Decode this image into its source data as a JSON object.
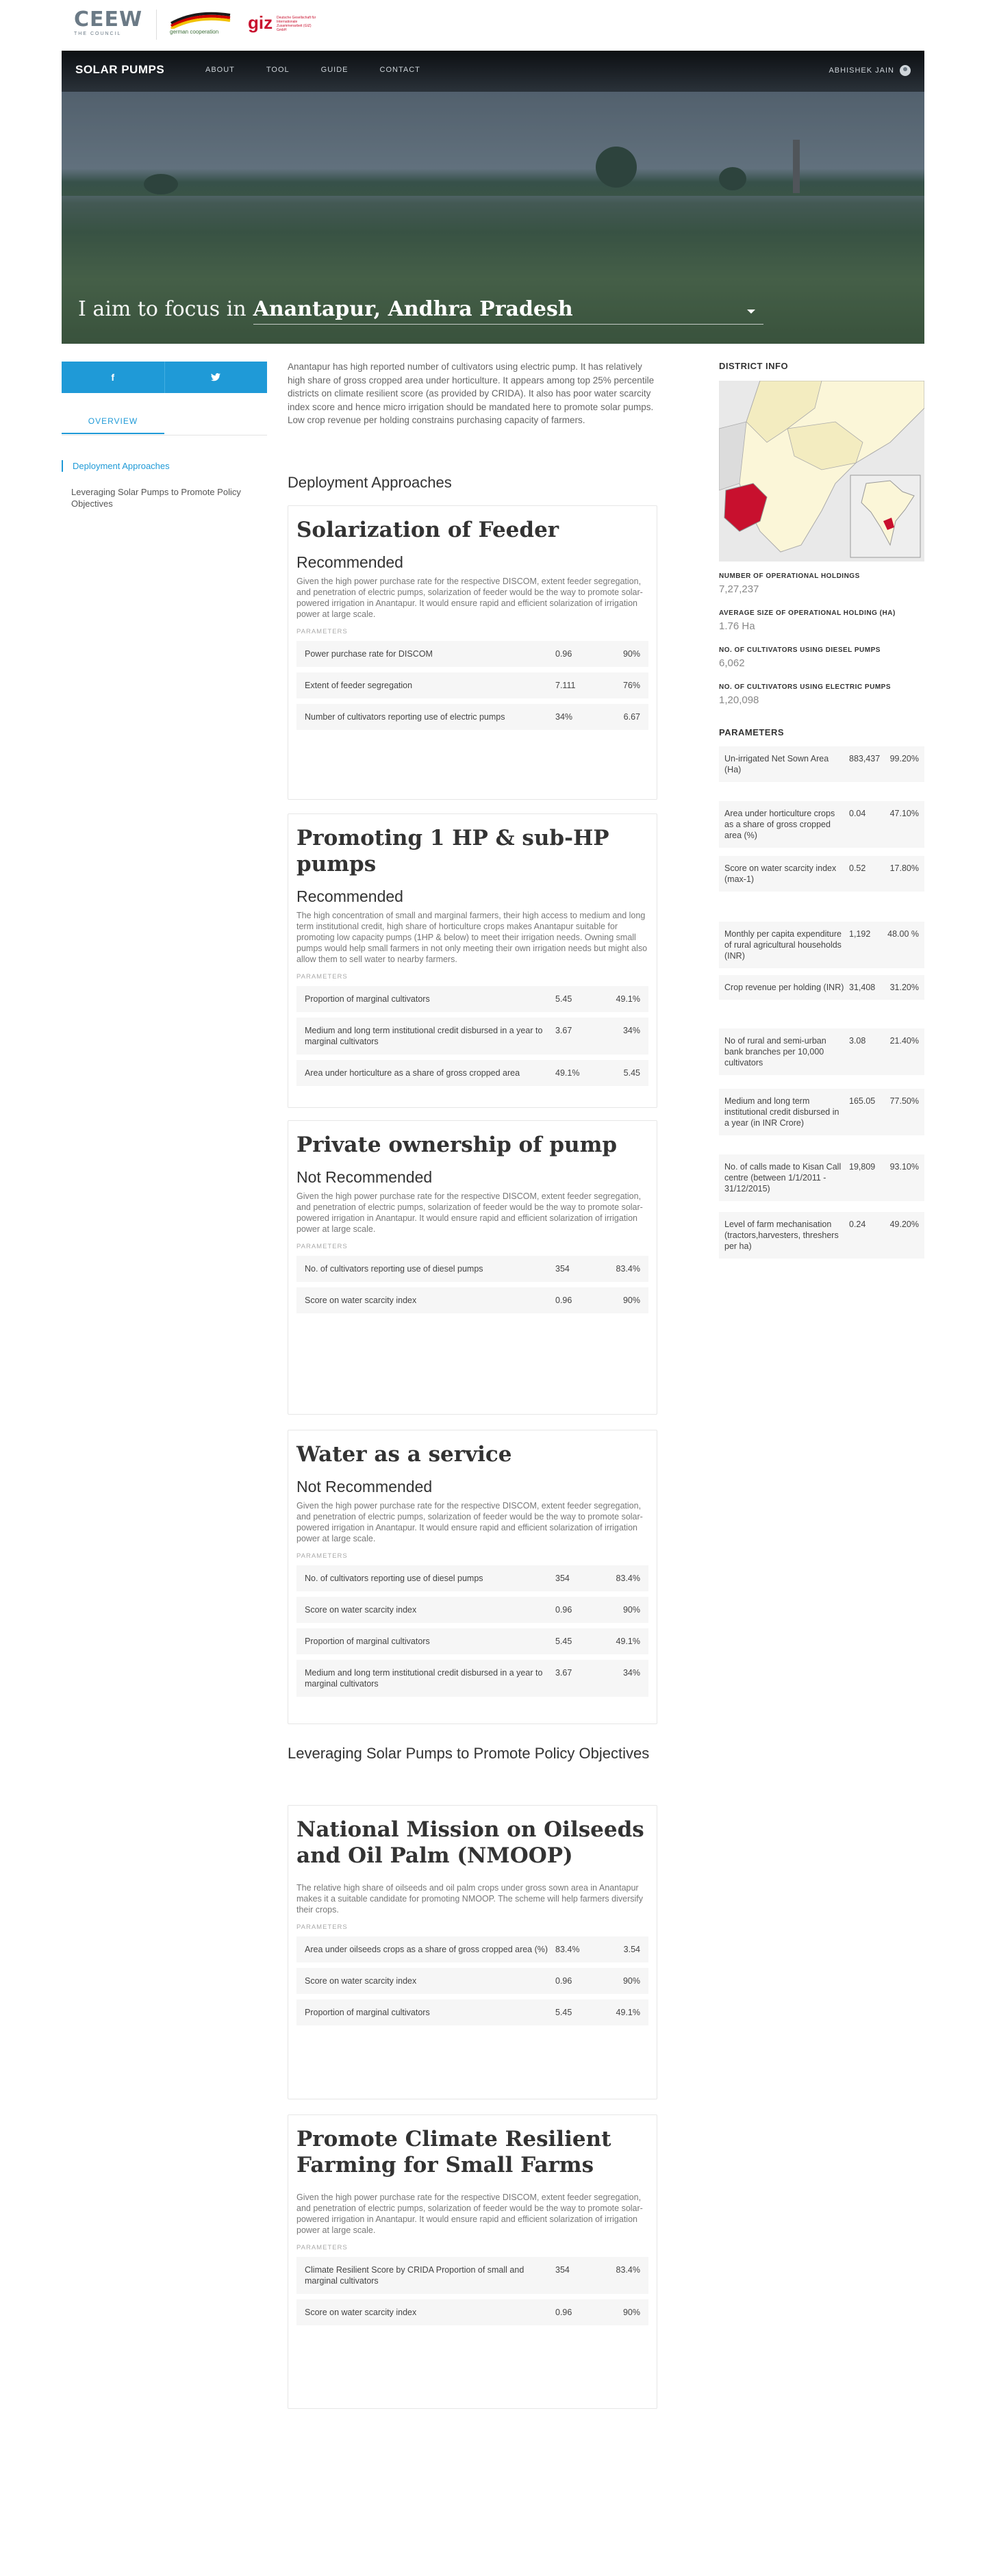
{
  "logos": {
    "ceew_mark": "CEEW",
    "ceew_sub": "THE COUNCIL",
    "german_text": "german cooperation",
    "giz": "giz",
    "giz_small": "Deutsche Gesellschaft für Internationale Zusammenarbeit (GIZ) GmbH"
  },
  "nav": {
    "brand": "SOLAR PUMPS",
    "links": [
      "ABOUT",
      "TOOL",
      "GUIDE",
      "CONTACT"
    ],
    "user": "ABHISHEK JAIN"
  },
  "hero": {
    "lead": "I aim to focus in",
    "place": "Anantapur, Andhra Pradesh"
  },
  "sidebar": {
    "tab": "OVERVIEW",
    "items": [
      "Deployment Approaches",
      "Leveraging Solar Pumps to Promote Policy Objectives"
    ]
  },
  "intro": "Anantapur has high reported number of cultivators using electric pump. It has relatively high share of gross cropped area under horticulture. It appears among top 25% percentile districts on climate resilient score (as provided by CRIDA). It also has poor water scarcity index score and hence micro irrigation should be mandated here to promote solar pumps. Low crop revenue per holding constrains purchasing capacity of farmers.",
  "sections": {
    "deployment": "Deployment Approaches",
    "leveraging": "Leveraging Solar Pumps to Promote Policy Objectives"
  },
  "params_label": "PARAMETERS",
  "cards": [
    {
      "title": "Solarization of Feeder",
      "rec": "Recommended",
      "desc": "Given the high power purchase rate for the respective DISCOM, extent feeder segregation, and penetration of electric pumps, solarization of feeder would be the way to promote solar-powered irrigation in Anantapur. It would ensure rapid and efficient solarization of irrigation power at large scale.",
      "params": [
        {
          "name": "Power purchase rate for DISCOM",
          "v1": "0.96",
          "v2": "90%"
        },
        {
          "name": "Extent of feeder segregation",
          "v1": "7.111",
          "v2": "76%"
        },
        {
          "name": "Number of cultivators reporting use of electric pumps",
          "v1": "34%",
          "v2": "6.67"
        }
      ]
    },
    {
      "title": "Promoting 1 HP & sub-HP pumps",
      "rec": "Recommended",
      "desc": "The high concentration of small and marginal farmers, their high access to medium and long term institutional credit, high share of horticulture crops makes Anantapur suitable for promoting low capacity pumps (1HP & below) to meet their irrigation needs. Owning small pumps would help small farmers in not only meeting their own irrigation needs but might also allow them to sell water to nearby farmers.",
      "params": [
        {
          "name": "Proportion of marginal cultivators",
          "v1": "5.45",
          "v2": "49.1%"
        },
        {
          "name": "Medium and long term institutional credit disbursed in a year to marginal cultivators",
          "v1": "3.67",
          "v2": "34%"
        },
        {
          "name": "Area under horticulture as a share of gross cropped area",
          "v1": "49.1%",
          "v2": "5.45"
        }
      ]
    },
    {
      "title": "Private ownership of pump",
      "rec": "Not Recommended",
      "desc": "Given the high power purchase rate for the respective DISCOM, extent feeder segregation, and penetration of electric pumps, solarization of feeder would be the way to promote solar-powered irrigation in Anantapur. It would ensure rapid and efficient solarization of irrigation power at large scale.",
      "params": [
        {
          "name": "No. of cultivators reporting use of diesel pumps",
          "v1": "354",
          "v2": "83.4%"
        },
        {
          "name": "Score on water scarcity index",
          "v1": "0.96",
          "v2": "90%"
        }
      ]
    },
    {
      "title": "Water as a service",
      "rec": "Not Recommended",
      "desc": "Given the high power purchase rate for the respective DISCOM, extent feeder segregation, and penetration of electric pumps, solarization of feeder would be the way to promote solar-powered irrigation in Anantapur. It would ensure rapid and efficient solarization of irrigation power at large scale.",
      "params": [
        {
          "name": "No. of cultivators reporting use of diesel pumps",
          "v1": "354",
          "v2": "83.4%"
        },
        {
          "name": "Score on water scarcity index",
          "v1": "0.96",
          "v2": "90%"
        },
        {
          "name": "Proportion of marginal cultivators",
          "v1": "5.45",
          "v2": "49.1%"
        },
        {
          "name": "Medium and long term institutional credit disbursed in a year to marginal cultivators",
          "v1": "3.67",
          "v2": "34%"
        }
      ]
    },
    {
      "title": "National Mission on Oilseeds and Oil Palm (NMOOP)",
      "rec": "",
      "desc": "The relative high share of oilseeds and oil palm crops under gross sown area in Anantapur makes it a suitable candidate for promoting NMOOP. The scheme will help farmers diversify their crops.",
      "params": [
        {
          "name": "Area under oilseeds crops as a share of gross cropped area (%)",
          "v1": "83.4%",
          "v2": "3.54"
        },
        {
          "name": "Score on water scarcity index",
          "v1": "0.96",
          "v2": "90%"
        },
        {
          "name": "Proportion of marginal cultivators",
          "v1": "5.45",
          "v2": "49.1%"
        }
      ]
    },
    {
      "title": "Promote Climate Resilient Farming for Small Farms",
      "rec": "",
      "desc": "Given the high power purchase rate for the respective DISCOM, extent feeder segregation, and penetration of electric pumps, solarization of feeder would be the way to promote solar-powered irrigation in Anantapur. It would ensure rapid and efficient solarization of irrigation power at large scale.",
      "params": [
        {
          "name": "Climate Resilient Score by CRIDA Proportion of small and marginal cultivators",
          "v1": "354",
          "v2": "83.4%"
        },
        {
          "name": "Score on water scarcity index",
          "v1": "0.96",
          "v2": "90%"
        }
      ]
    }
  ],
  "district": {
    "title": "DISTRICT INFO",
    "stats": [
      {
        "label": "NUMBER OF OPERATIONAL HOLDINGS",
        "value": "7,27,237"
      },
      {
        "label": "AVERAGE SIZE OF OPERATIONAL HOLDING (HA)",
        "value": "1.76 Ha"
      },
      {
        "label": "NO. OF CULTIVATORS USING DIESEL PUMPS",
        "value": "6,062"
      },
      {
        "label": "NO. OF CULTIVATORS USING ELECTRIC PUMPS",
        "value": "1,20,098"
      }
    ]
  },
  "parameters": {
    "title": "PARAMETERS",
    "rows": [
      {
        "name": "Un-irrigated Net Sown Area (Ha)",
        "v1": "883,437",
        "v2": "99.20%"
      },
      {
        "name": "Area under horticulture crops as a share of gross cropped area (%)",
        "v1": "0.04",
        "v2": "47.10%"
      },
      {
        "name": "Score on water scarcity index (max-1)",
        "v1": "0.52",
        "v2": "17.80%"
      },
      {
        "name": "Monthly per capita expenditure of rural agricultural households (INR)",
        "v1": "1,192",
        "v2": "48.00 %"
      },
      {
        "name": "Crop revenue per holding (INR)",
        "v1": "31,408",
        "v2": "31.20%"
      },
      {
        "name": "No of rural and semi-urban bank branches per 10,000 cultivators",
        "v1": "3.08",
        "v2": "21.40%"
      },
      {
        "name": "Medium and long term institutional credit disbursed in a year (in INR Crore)",
        "v1": "165.05",
        "v2": "77.50%"
      },
      {
        "name": "No. of calls made to Kisan Call centre (between 1/1/2011 - 31/12/2015)",
        "v1": "19,809",
        "v2": "93.10%"
      },
      {
        "name": "Level of farm mechanisation (tractors,harvesters, threshers per ha)",
        "v1": "0.24",
        "v2": "49.20%"
      }
    ]
  },
  "colors": {
    "accent": "#1f9ad7",
    "highlight_district": "#c8102e"
  }
}
